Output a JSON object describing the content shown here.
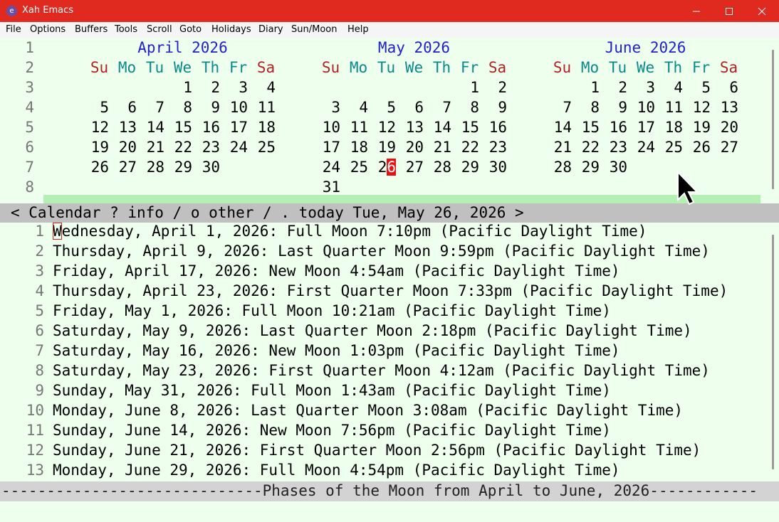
{
  "window": {
    "title": "Xah Emacs",
    "icon": "emacs-icon"
  },
  "menu": [
    "File",
    "Options",
    "Buffers",
    "Tools",
    "Scroll",
    "Goto",
    "Holidays",
    "Diary",
    "Sun/Moon",
    "Help"
  ],
  "calendar": {
    "line_numbers": [
      "1",
      "2",
      "3",
      "4",
      "5",
      "6",
      "7",
      "8"
    ],
    "weekday_names": [
      "Su",
      "Mo",
      "Tu",
      "We",
      "Th",
      "Fr",
      "Sa"
    ],
    "months": [
      {
        "header": "April 2026",
        "first_weekday": 3,
        "days": 30
      },
      {
        "header": "May 2026",
        "first_weekday": 5,
        "days": 31
      },
      {
        "header": "June 2026",
        "first_weekday": 1,
        "days": 30
      }
    ],
    "today_month_index": 1,
    "today_day": 26,
    "mode_line": "< Calendar ? info / o other / . today Tue, May 26, 2026 >"
  },
  "moon": {
    "lines": [
      "Wednesday, April 1, 2026: Full Moon 7:10pm (Pacific Daylight Time)",
      "Thursday, April 9, 2026: Last Quarter Moon 9:59pm (Pacific Daylight Time)",
      "Friday, April 17, 2026: New Moon 4:54am (Pacific Daylight Time)",
      "Thursday, April 23, 2026: First Quarter Moon 7:33pm (Pacific Daylight Time)",
      "Friday, May 1, 2026: Full Moon 10:21am (Pacific Daylight Time)",
      "Saturday, May 9, 2026: Last Quarter Moon 2:18pm (Pacific Daylight Time)",
      "Saturday, May 16, 2026: New Moon 1:03pm (Pacific Daylight Time)",
      "Saturday, May 23, 2026: First Quarter Moon 4:12am (Pacific Daylight Time)",
      "Sunday, May 31, 2026: Full Moon 1:43am (Pacific Daylight Time)",
      "Monday, June 8, 2026: Last Quarter Moon 3:08am (Pacific Daylight Time)",
      "Sunday, June 14, 2026: New Moon 7:56pm (Pacific Daylight Time)",
      "Sunday, June 21, 2026: First Quarter Moon 2:56pm (Pacific Daylight Time)",
      "Monday, June 29, 2026: Full Moon 4:54pm (Pacific Daylight Time)"
    ],
    "mode_line": "-----------------------------Phases of the Moon from April to June, 2026------------"
  },
  "colors": {
    "titlebar": "#e02a20",
    "buffer_bg": "#eeffee",
    "highlight_row": "#b4f0b4",
    "month_header": "#1f1fd0",
    "weekend": "#b22222",
    "weekday": "#0a8a8a",
    "today_bg": "#e81010"
  }
}
